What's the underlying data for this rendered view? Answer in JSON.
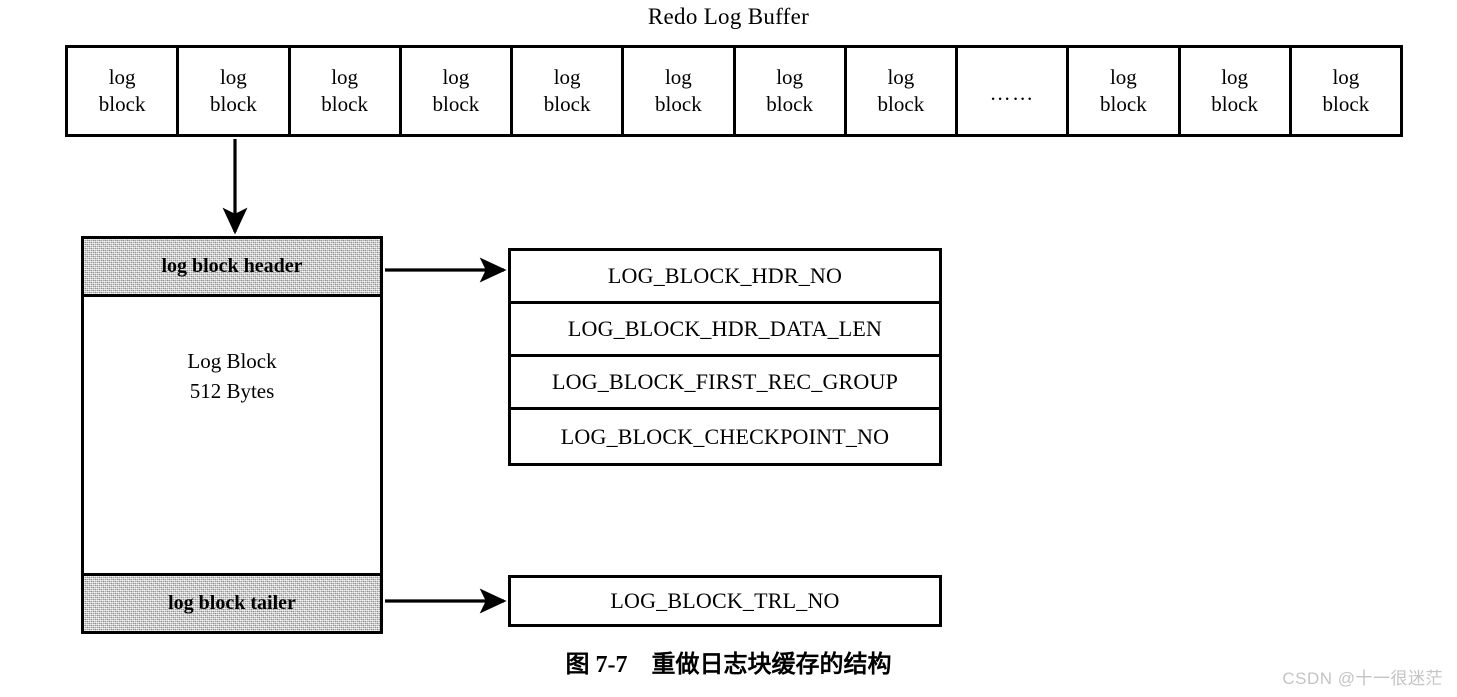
{
  "title": "Redo Log Buffer",
  "buffer": {
    "cells": [
      {
        "line1": "log",
        "line2": "block"
      },
      {
        "line1": "log",
        "line2": "block"
      },
      {
        "line1": "log",
        "line2": "block"
      },
      {
        "line1": "log",
        "line2": "block"
      },
      {
        "line1": "log",
        "line2": "block"
      },
      {
        "line1": "log",
        "line2": "block"
      },
      {
        "line1": "log",
        "line2": "block"
      },
      {
        "line1": "log",
        "line2": "block"
      },
      {
        "line1": "……",
        "line2": ""
      },
      {
        "line1": "log",
        "line2": "block"
      },
      {
        "line1": "log",
        "line2": "block"
      },
      {
        "line1": "log",
        "line2": "block"
      }
    ]
  },
  "log_block": {
    "header_label": "log block header",
    "body_line1": "Log Block",
    "body_line2": "512 Bytes",
    "tailer_label": "log block tailer"
  },
  "header_fields": [
    "LOG_BLOCK_HDR_NO",
    "LOG_BLOCK_HDR_DATA_LEN",
    "LOG_BLOCK_FIRST_REC_GROUP",
    "LOG_BLOCK_CHECKPOINT_NO"
  ],
  "tailer_field": "LOG_BLOCK_TRL_NO",
  "caption": "图 7-7　重做日志块缓存的结构",
  "watermark": "CSDN @十一很迷茫",
  "colors": {
    "stroke": "#000000",
    "band_fill": "#c9c9c9",
    "background": "#ffffff",
    "watermark": "#c4c4c4"
  }
}
